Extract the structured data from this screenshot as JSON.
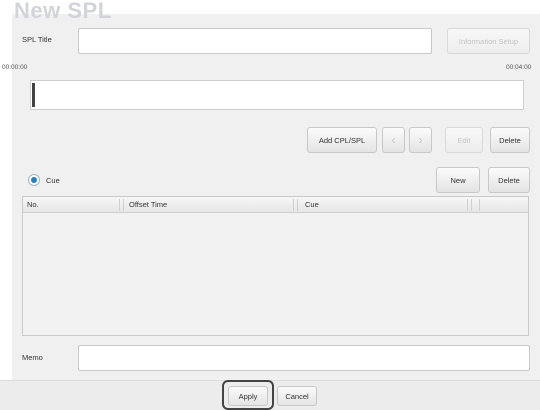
{
  "page_title": "New SPL",
  "spl_title": {
    "label": "SPL Title",
    "value": "",
    "info_button": "Information Setup"
  },
  "timeline": {
    "start": "00:00:00",
    "end": "00:04:00"
  },
  "cpl_toolbar": {
    "add": "Add CPL/SPL",
    "prev": "‹",
    "next": "›",
    "edit": "Edit",
    "delete": "Delete"
  },
  "cue": {
    "radio_label": "Cue",
    "new": "New",
    "delete": "Delete"
  },
  "table": {
    "columns": [
      "No.",
      "Offset Time",
      "Cue"
    ]
  },
  "memo": {
    "label": "Memo",
    "value": ""
  },
  "footer": {
    "apply": "Apply",
    "cancel": "Cancel"
  }
}
